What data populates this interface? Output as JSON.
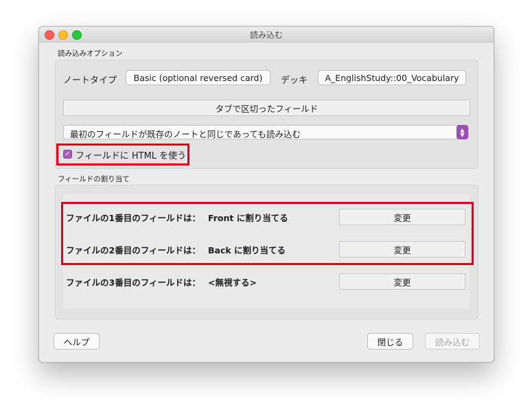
{
  "window": {
    "title": "読み込む"
  },
  "import_options": {
    "section_label": "読み込みオプション",
    "note_type_label": "ノートタイプ",
    "note_type_value": "Basic (optional reversed card)",
    "deck_label": "デッキ",
    "deck_value": "A_EnglishStudy::00_Vocabulary",
    "separator_button": "タブで区切ったフィールド",
    "duplicate_option": "最初のフィールドが既存のノートと同じであっても読み込む",
    "html_checkbox_label": "フィールドに HTML を使う",
    "html_checkbox_checked": true
  },
  "field_mapping": {
    "section_label": "フィールドの割り当て",
    "rows": [
      {
        "label": "ファイルの1番目のフィールドは：",
        "value": "Front に割り当てる",
        "button": "変更"
      },
      {
        "label": "ファイルの2番目のフィールドは：",
        "value": "Back に割り当てる",
        "button": "変更"
      },
      {
        "label": "ファイルの3番目のフィールドは：",
        "value": "<無視する>",
        "button": "変更"
      }
    ]
  },
  "footer": {
    "help_button": "ヘルプ",
    "close_button": "閉じる",
    "import_button": "読み込む"
  },
  "colors": {
    "highlight": "#e4001b",
    "accent": "#a05cb8"
  }
}
